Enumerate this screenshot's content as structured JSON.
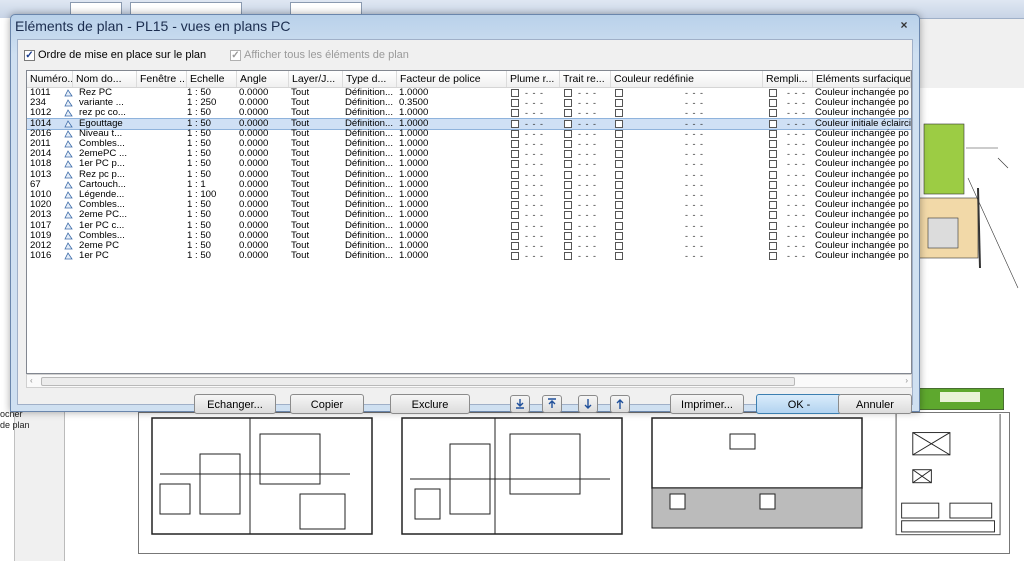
{
  "dialog": {
    "title": "Eléments de plan - PL15 - vues en plans PC",
    "close_glyph": "×",
    "checkbox_order": {
      "label": "Ordre de mise en place sur le plan",
      "checked": true
    },
    "checkbox_show_all": {
      "label": "Afficher tous les éléments de plan",
      "checked": true,
      "enabled": false
    }
  },
  "background": {
    "sidebar_text_1": "ocher",
    "sidebar_text_2": "de plan"
  },
  "table": {
    "headers": [
      "Numéro...",
      "Nom do...",
      "Fenêtre ...",
      "Echelle",
      "Angle",
      "Layer/J...",
      "Type d...",
      "Facteur de police",
      "Plume r...",
      "Trait re...",
      "Couleur redéfinie",
      "Rempli...",
      "Eléments surfaciques"
    ],
    "rows": [
      {
        "num": "1011",
        "name": "Rez PC",
        "scale": "1 : 50",
        "angle": "0.0000",
        "layer": "Tout",
        "type": "Définition...",
        "factor": "1.0000",
        "surf": "Couleur inchangée po",
        "selected": false
      },
      {
        "num": "234",
        "name": "variante ...",
        "scale": "1 : 250",
        "angle": "0.0000",
        "layer": "Tout",
        "type": "Définition...",
        "factor": "0.3500",
        "surf": "Couleur inchangée po",
        "selected": false
      },
      {
        "num": "1012",
        "name": "rez pc co...",
        "scale": "1 : 50",
        "angle": "0.0000",
        "layer": "Tout",
        "type": "Définition...",
        "factor": "1.0000",
        "surf": "Couleur inchangée po",
        "selected": false
      },
      {
        "num": "1014",
        "name": "Egouttage",
        "scale": "1 : 50",
        "angle": "0.0000",
        "layer": "Tout",
        "type": "Définition...",
        "factor": "1.0000",
        "surf": "Couleur initiale éclairci",
        "selected": true
      },
      {
        "num": "2016",
        "name": "Niveau t...",
        "scale": "1 : 50",
        "angle": "0.0000",
        "layer": "Tout",
        "type": "Définition...",
        "factor": "1.0000",
        "surf": "Couleur inchangée po",
        "selected": false
      },
      {
        "num": "2011",
        "name": "Combles...",
        "scale": "1 : 50",
        "angle": "0.0000",
        "layer": "Tout",
        "type": "Définition...",
        "factor": "1.0000",
        "surf": "Couleur inchangée po",
        "selected": false
      },
      {
        "num": "2014",
        "name": "2emePC ...",
        "scale": "1 : 50",
        "angle": "0.0000",
        "layer": "Tout",
        "type": "Définition...",
        "factor": "1.0000",
        "surf": "Couleur inchangée po",
        "selected": false
      },
      {
        "num": "1018",
        "name": "1er PC p...",
        "scale": "1 : 50",
        "angle": "0.0000",
        "layer": "Tout",
        "type": "Définition...",
        "factor": "1.0000",
        "surf": "Couleur inchangée po",
        "selected": false
      },
      {
        "num": "1013",
        "name": "Rez pc p...",
        "scale": "1 : 50",
        "angle": "0.0000",
        "layer": "Tout",
        "type": "Définition...",
        "factor": "1.0000",
        "surf": "Couleur inchangée po",
        "selected": false
      },
      {
        "num": "67",
        "name": "Cartouch...",
        "scale": "1 : 1",
        "angle": "0.0000",
        "layer": "Tout",
        "type": "Définition...",
        "factor": "1.0000",
        "surf": "Couleur inchangée po",
        "selected": false
      },
      {
        "num": "1010",
        "name": "Légende...",
        "scale": "1 : 100",
        "angle": "0.0000",
        "layer": "Tout",
        "type": "Définition...",
        "factor": "1.0000",
        "surf": "Couleur inchangée po",
        "selected": false
      },
      {
        "num": "1020",
        "name": "Combles...",
        "scale": "1 : 50",
        "angle": "0.0000",
        "layer": "Tout",
        "type": "Définition...",
        "factor": "1.0000",
        "surf": "Couleur inchangée po",
        "selected": false
      },
      {
        "num": "2013",
        "name": "2eme PC...",
        "scale": "1 : 50",
        "angle": "0.0000",
        "layer": "Tout",
        "type": "Définition...",
        "factor": "1.0000",
        "surf": "Couleur inchangée po",
        "selected": false
      },
      {
        "num": "1017",
        "name": "1er PC c...",
        "scale": "1 : 50",
        "angle": "0.0000",
        "layer": "Tout",
        "type": "Définition...",
        "factor": "1.0000",
        "surf": "Couleur inchangée po",
        "selected": false
      },
      {
        "num": "1019",
        "name": "Combles...",
        "scale": "1 : 50",
        "angle": "0.0000",
        "layer": "Tout",
        "type": "Définition...",
        "factor": "1.0000",
        "surf": "Couleur inchangée po",
        "selected": false
      },
      {
        "num": "2012",
        "name": "2eme PC",
        "scale": "1 : 50",
        "angle": "0.0000",
        "layer": "Tout",
        "type": "Définition...",
        "factor": "1.0000",
        "surf": "Couleur inchangée po",
        "selected": false
      },
      {
        "num": "1016",
        "name": "1er PC",
        "scale": "1 : 50",
        "angle": "0.0000",
        "layer": "Tout",
        "type": "Définition...",
        "factor": "1.0000",
        "surf": "Couleur inchangée po",
        "selected": false
      }
    ],
    "dash_text": "- - -"
  },
  "buttons": {
    "echanger": "Echanger...",
    "copier": "Copier",
    "exclure": "Exclure",
    "imprimer": "Imprimer...",
    "ok": "OK -",
    "annuler": "Annuler"
  },
  "icon_buttons": [
    "move-bottom-icon",
    "move-top-icon",
    "move-down-icon",
    "move-up-icon"
  ],
  "colors": {
    "selection": "#cfe0f5",
    "title": "#1b2d4f",
    "dialog_frame": "#b9d1ea"
  }
}
